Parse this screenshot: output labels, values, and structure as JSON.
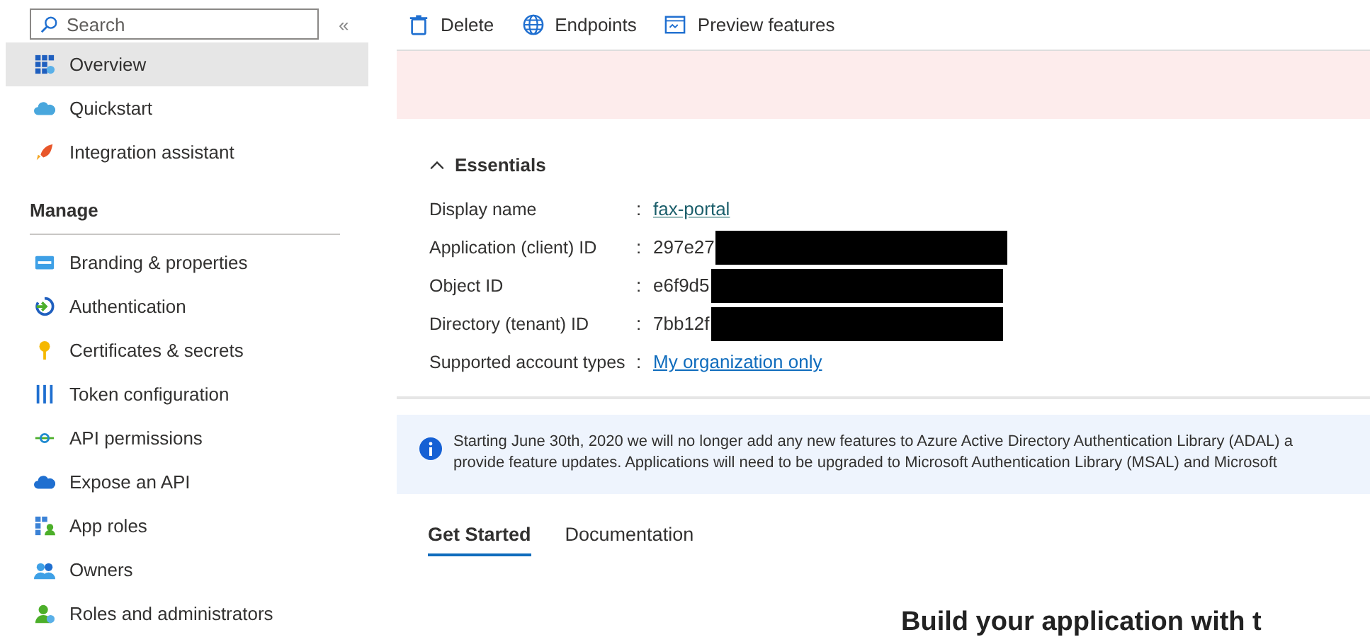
{
  "sidebar": {
    "search": {
      "placeholder": "Search"
    },
    "collapse": "«",
    "items": [
      {
        "label": "Overview",
        "selected": true
      },
      {
        "label": "Quickstart",
        "selected": false
      },
      {
        "label": "Integration assistant",
        "selected": false
      }
    ],
    "section": "Manage",
    "manage_items": [
      {
        "label": "Branding & properties",
        "selected": false
      },
      {
        "label": "Authentication",
        "selected": false
      },
      {
        "label": "Certificates & secrets",
        "selected": false
      },
      {
        "label": "Token configuration",
        "selected": false
      },
      {
        "label": "API permissions",
        "selected": false
      },
      {
        "label": "Expose an API",
        "selected": false
      },
      {
        "label": "App roles",
        "selected": false
      },
      {
        "label": "Owners",
        "selected": false
      },
      {
        "label": "Roles and administrators",
        "selected": false
      }
    ]
  },
  "toolbar": [
    {
      "label": "Delete"
    },
    {
      "label": "Endpoints"
    },
    {
      "label": "Preview features"
    }
  ],
  "essentials": {
    "title": "Essentials",
    "expanded": true,
    "rows": [
      {
        "label": "Display name",
        "separator": ":",
        "value": "fax-portal",
        "kind": "link",
        "redacted": false
      },
      {
        "label": "Application (client) ID",
        "separator": ":",
        "value": "297e27",
        "kind": "text",
        "redacted": true
      },
      {
        "label": "Object ID",
        "separator": ":",
        "value": "e6f9d5",
        "kind": "text",
        "redacted": true
      },
      {
        "label": "Directory (tenant) ID",
        "separator": ":",
        "value": "7bb12f",
        "kind": "text",
        "redacted": true
      },
      {
        "label": "Supported account types",
        "separator": ":",
        "value": "My organization only",
        "kind": "bluelink",
        "redacted": false
      }
    ]
  },
  "notice": {
    "lines": [
      "Starting June 30th, 2020 we will no longer add any new features to Azure Active Directory Authentication Library (ADAL) a",
      "provide feature updates. Applications will need to be upgraded to Microsoft Authentication Library (MSAL) and Microsoft"
    ]
  },
  "tabs": [
    {
      "label": "Get Started",
      "selected": true
    },
    {
      "label": "Documentation",
      "selected": false
    }
  ],
  "heading": "Build your application with t"
}
